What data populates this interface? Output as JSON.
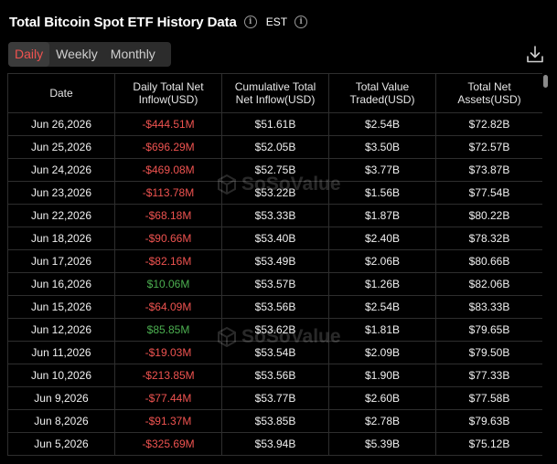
{
  "header": {
    "title": "Total Bitcoin Spot ETF History Data",
    "timezone": "EST"
  },
  "tabs": [
    {
      "label": "Daily",
      "active": true
    },
    {
      "label": "Weekly",
      "active": false
    },
    {
      "label": "Monthly",
      "active": false
    }
  ],
  "table": {
    "columns": [
      "Date",
      "Daily Total Net Inflow(USD)",
      "Cumulative Total Net Inflow(USD)",
      "Total Value Traded(USD)",
      "Total Net Assets(USD)"
    ],
    "rows": [
      [
        "Jun 26,2026",
        "-$444.51M",
        "$51.61B",
        "$2.54B",
        "$72.82B"
      ],
      [
        "Jun 25,2026",
        "-$696.29M",
        "$52.05B",
        "$3.50B",
        "$72.57B"
      ],
      [
        "Jun 24,2026",
        "-$469.08M",
        "$52.75B",
        "$3.77B",
        "$73.87B"
      ],
      [
        "Jun 23,2026",
        "-$113.78M",
        "$53.22B",
        "$1.56B",
        "$77.54B"
      ],
      [
        "Jun 22,2026",
        "-$68.18M",
        "$53.33B",
        "$1.87B",
        "$80.22B"
      ],
      [
        "Jun 18,2026",
        "-$90.66M",
        "$53.40B",
        "$2.40B",
        "$78.32B"
      ],
      [
        "Jun 17,2026",
        "-$82.16M",
        "$53.49B",
        "$2.06B",
        "$80.66B"
      ],
      [
        "Jun 16,2026",
        "$10.06M",
        "$53.57B",
        "$1.26B",
        "$82.06B"
      ],
      [
        "Jun 15,2026",
        "-$64.09M",
        "$53.56B",
        "$2.54B",
        "$83.33B"
      ],
      [
        "Jun 12,2026",
        "$85.85M",
        "$53.62B",
        "$1.81B",
        "$79.65B"
      ],
      [
        "Jun 11,2026",
        "-$19.03M",
        "$53.54B",
        "$2.09B",
        "$79.50B"
      ],
      [
        "Jun 10,2026",
        "-$213.85M",
        "$53.56B",
        "$1.90B",
        "$77.33B"
      ],
      [
        "Jun 9,2026",
        "-$77.44M",
        "$53.77B",
        "$2.60B",
        "$77.58B"
      ],
      [
        "Jun 8,2026",
        "-$91.37M",
        "$53.85B",
        "$2.78B",
        "$79.63B"
      ],
      [
        "Jun 5,2026",
        "-$325.69M",
        "$53.94B",
        "$5.39B",
        "$75.12B"
      ]
    ]
  },
  "watermark": {
    "text": "SoSoValue"
  },
  "colors": {
    "negative": "#ef5350",
    "positive": "#4caf50",
    "active_tab": "#ef5350"
  },
  "icons": {
    "info": "info-icon",
    "download": "download-icon",
    "watermark_logo": "cube-logo-icon"
  }
}
